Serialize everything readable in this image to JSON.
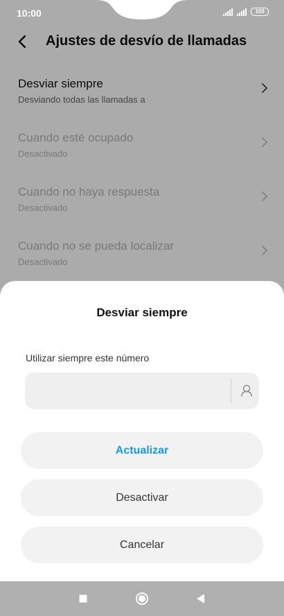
{
  "status_bar": {
    "time": "10:00",
    "battery": "100"
  },
  "header": {
    "title": "Ajustes de desvío de llamadas"
  },
  "settings": [
    {
      "title": "Desviar siempre",
      "subtitle": "Desviando todas las llamadas a",
      "enabled": true
    },
    {
      "title": "Cuando esté ocupado",
      "subtitle": "Desactivado",
      "enabled": false
    },
    {
      "title": "Cuando no haya respuesta",
      "subtitle": "Desactivado",
      "enabled": false
    },
    {
      "title": "Cuando no se pueda localizar",
      "subtitle": "Desactivado",
      "enabled": false
    }
  ],
  "dialog": {
    "title": "Desviar siempre",
    "field_label": "Utilizar siempre este número",
    "field_value": "",
    "buttons": {
      "update": "Actualizar",
      "deactivate": "Desactivar",
      "cancel": "Cancelar"
    }
  },
  "colors": {
    "accent": "#1a97e8",
    "overlay": "rgba(0,0,0,0.33)",
    "nav_bar": "#b0b0b0"
  },
  "icons": {
    "back": "back-arrow-icon",
    "chevron": "chevron-right-icon",
    "contact": "contact-person-icon",
    "nav": [
      "square-recents-icon",
      "circle-home-icon",
      "triangle-back-icon"
    ]
  }
}
